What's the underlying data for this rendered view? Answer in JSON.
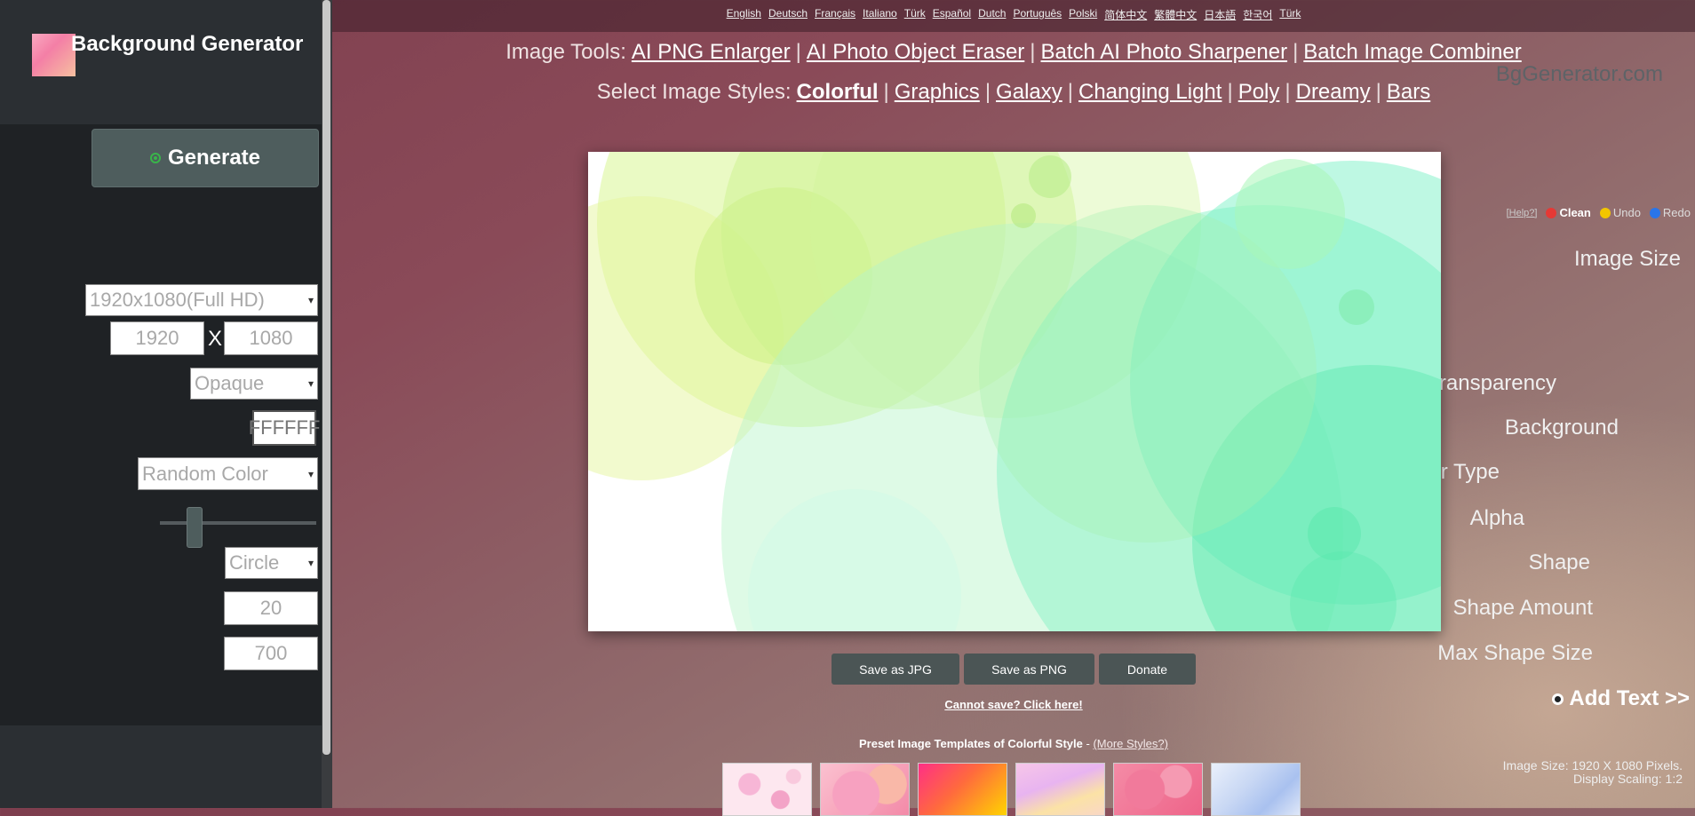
{
  "brand": {
    "title": "Background Generator",
    "domain": "BgGenerator.com"
  },
  "sidebar": {
    "generate_label": "Generate",
    "help_label": "[Help?]",
    "clean_label": "Clean",
    "undo_label": "Undo",
    "redo_label": "Redo",
    "image_size_label": "Image Size",
    "image_size_selected": "1920x1080(Full HD)",
    "width_value": "1920",
    "size_separator": "X",
    "height_value": "1080",
    "transparency_label": "Transparency",
    "transparency_selected": "Opaque",
    "background_label": "Background",
    "background_value": "FFFFFF",
    "color_type_label": "Color Type",
    "color_type_selected": "Random Color",
    "alpha_label": "Alpha",
    "shape_label": "Shape",
    "shape_selected": "Circle",
    "shape_amount_label": "Shape Amount",
    "shape_amount_value": "20",
    "max_shape_size_label": "Max Shape Size",
    "max_shape_size_value": "700",
    "add_text_label": "Add Text >>",
    "footer_size": "Image Size: 1920 X 1080 Pixels.",
    "footer_scaling": "Display Scaling: 1:2"
  },
  "languages": [
    "English",
    "Deutsch",
    "Français",
    "Italiano",
    "Türk",
    "Español",
    "Dutch",
    "Português",
    "Polski",
    "简体中文",
    "繁體中文",
    "日本語",
    "한국어",
    "Türk"
  ],
  "tools": {
    "label": "Image Tools:",
    "links": [
      "AI PNG Enlarger",
      "AI Photo Object Eraser",
      "Batch AI Photo Sharpener",
      "Batch Image Combiner"
    ]
  },
  "styles": {
    "label": "Select Image Styles:",
    "links": [
      "Colorful",
      "Graphics",
      "Galaxy",
      "Changing Light",
      "Poly",
      "Dreamy",
      "Bars"
    ],
    "active": "Colorful"
  },
  "actions": {
    "save_jpg": "Save as JPG",
    "save_png": "Save as PNG",
    "donate": "Donate",
    "cannot_save": "Cannot save? Click here!"
  },
  "presets": {
    "title": "Preset Image Templates of Colorful Style",
    "dash": " - ",
    "more": "(More Styles?)"
  },
  "colors": {
    "sidebar_bg": "#1f2225",
    "button_bg": "#4e5d5d",
    "canvas_green": "#5ff0b4",
    "canvas_yellow": "#d9f58a"
  }
}
